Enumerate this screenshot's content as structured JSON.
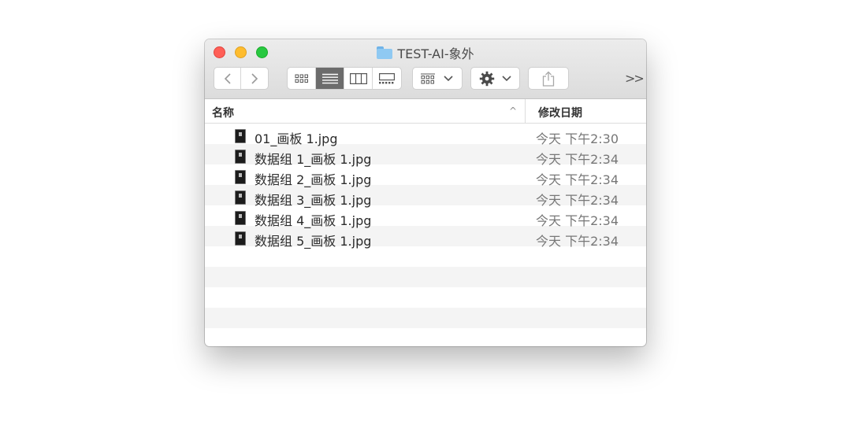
{
  "window": {
    "title": "TEST-AI-象外"
  },
  "toolbar": {
    "back_icon": "chevron-left-icon",
    "forward_icon": "chevron-right-icon",
    "view_modes": [
      "icon-view",
      "list-view",
      "column-view",
      "gallery-view"
    ],
    "active_view": "list-view",
    "overflow_label": ">>"
  },
  "columns": {
    "name": "名称",
    "date": "修改日期",
    "sort_indicator": "^"
  },
  "files": [
    {
      "name": "01_画板 1.jpg",
      "date": "今天 下午2:30"
    },
    {
      "name": "数据组 1_画板 1.jpg",
      "date": "今天 下午2:34"
    },
    {
      "name": "数据组 2_画板 1.jpg",
      "date": "今天 下午2:34"
    },
    {
      "name": "数据组 3_画板 1.jpg",
      "date": "今天 下午2:34"
    },
    {
      "name": "数据组 4_画板 1.jpg",
      "date": "今天 下午2:34"
    },
    {
      "name": "数据组 5_画板 1.jpg",
      "date": "今天 下午2:34"
    }
  ],
  "colors": {
    "close": "#ff5f57",
    "minimize": "#febc2e",
    "maximize": "#28c840",
    "folder": "#8fc9f2"
  }
}
